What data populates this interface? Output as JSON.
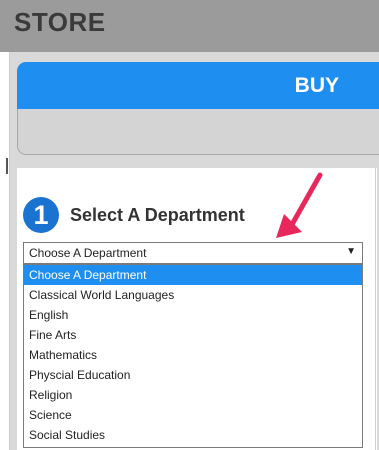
{
  "header": {
    "title": "STORE"
  },
  "buy_bar": {
    "label": "BUY"
  },
  "step": {
    "number": "1",
    "title": "Select A Department"
  },
  "department_select": {
    "selected": "Choose A Department",
    "options": [
      "Choose A Department",
      "Classical World Languages",
      "English",
      "Fine Arts",
      "Mathematics",
      "Physcial Education",
      "Religion",
      "Science",
      "Social Studies"
    ]
  },
  "colors": {
    "accent": "#1e8ff0",
    "step_badge": "#1a73d0",
    "arrow": "#e8285a",
    "header_bg": "#9b9b9b"
  }
}
